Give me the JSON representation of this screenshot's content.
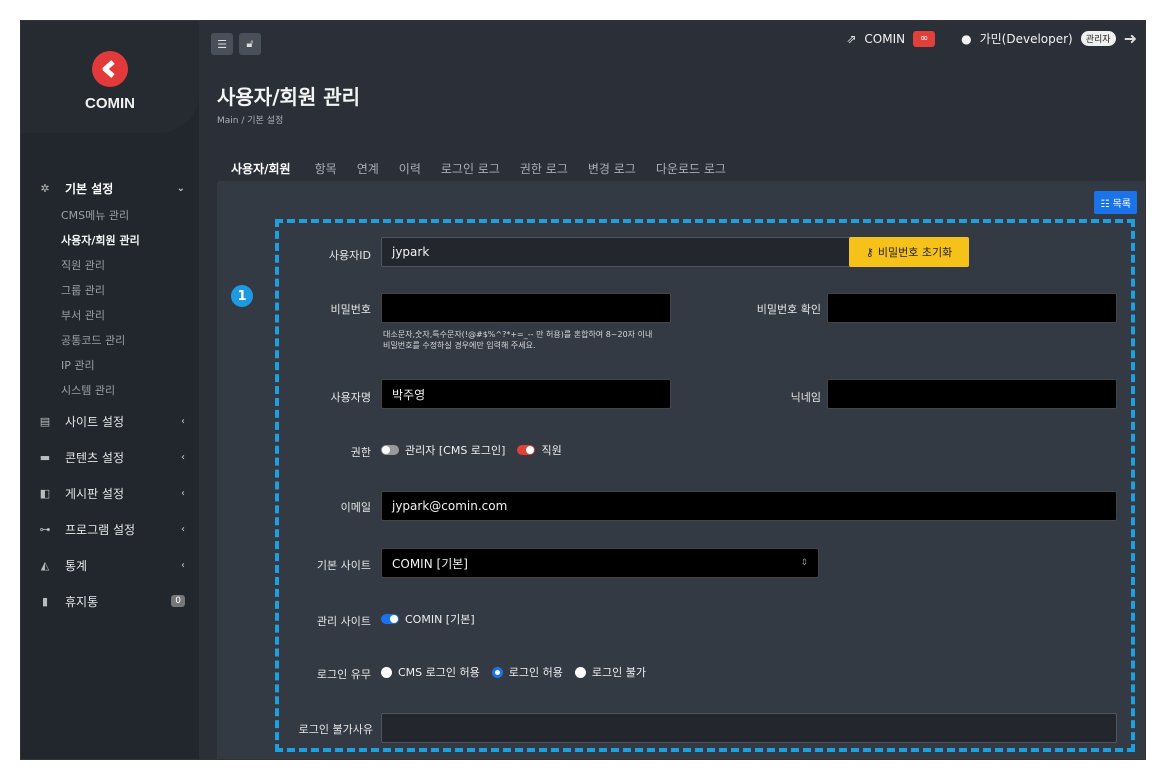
{
  "brand": {
    "name": "COMIN",
    "accent": "#e23a3a"
  },
  "sidebar": {
    "groups": [
      {
        "label": "기본 설정",
        "icon": "gears-icon",
        "arrow": "⌄",
        "expanded": true,
        "items": [
          "CMS메뉴 관리",
          "사용자/회원 관리",
          "직원 관리",
          "그룹 관리",
          "부서 관리",
          "공통코드 관리",
          "IP 관리",
          "시스템 관리"
        ],
        "active_item": "사용자/회원 관리"
      },
      {
        "label": "사이트 설정",
        "icon": "server-icon",
        "arrow": "‹"
      },
      {
        "label": "콘텐츠 설정",
        "icon": "folder-icon",
        "arrow": "‹"
      },
      {
        "label": "게시판 설정",
        "icon": "comments-icon",
        "arrow": "‹"
      },
      {
        "label": "프로그램 설정",
        "icon": "sitemap-icon",
        "arrow": "‹"
      },
      {
        "label": "통계",
        "icon": "chart-icon",
        "arrow": "‹"
      },
      {
        "label": "휴지통",
        "icon": "trash-icon",
        "badge": "0"
      }
    ]
  },
  "topbar": {
    "site_link": "COMIN",
    "user": "가민(Developer)",
    "role_badge": "관리자"
  },
  "page": {
    "title": "사용자/회원 관리",
    "breadcrumb": "Main / 기본 설정"
  },
  "tabs": [
    "사용자/회원",
    "항목",
    "연계",
    "이력",
    "로그인 로그",
    "권한 로그",
    "변경 로그",
    "다운로드 로그"
  ],
  "list_button": "목록",
  "step_marker": "1",
  "form": {
    "user_id_label": "사용자ID",
    "user_id_value": "jypark",
    "reset_pw_button": "비밀번호 초기화",
    "password_label": "비밀번호",
    "password_confirm_label": "비밀번호 확인",
    "password_help_1": "대소문자,숫자,특수문자(!@#$%^?*+=_-- 만 허용)를 혼합하여 8~20자 이내",
    "password_help_2": "비밀번호를 수정하실 경우에만 입력해 주세요.",
    "name_label": "사용자명",
    "name_value": "박주영",
    "nickname_label": "닉네임",
    "permission_label": "권한",
    "permission_admin": "관리자 [CMS 로그인]",
    "permission_staff": "직원",
    "email_label": "이메일",
    "email_value": "jypark@comin.com",
    "default_site_label": "기본 사이트",
    "default_site_value": "COMIN [기본]",
    "managed_site_label": "관리 사이트",
    "managed_site_value": "COMIN [기본]",
    "login_label": "로그인 유무",
    "login_options": [
      "CMS 로그인 허용",
      "로그인 허용",
      "로그인 불가"
    ],
    "login_selected": "로그인 허용",
    "login_block_label": "로그인 불가사유"
  }
}
